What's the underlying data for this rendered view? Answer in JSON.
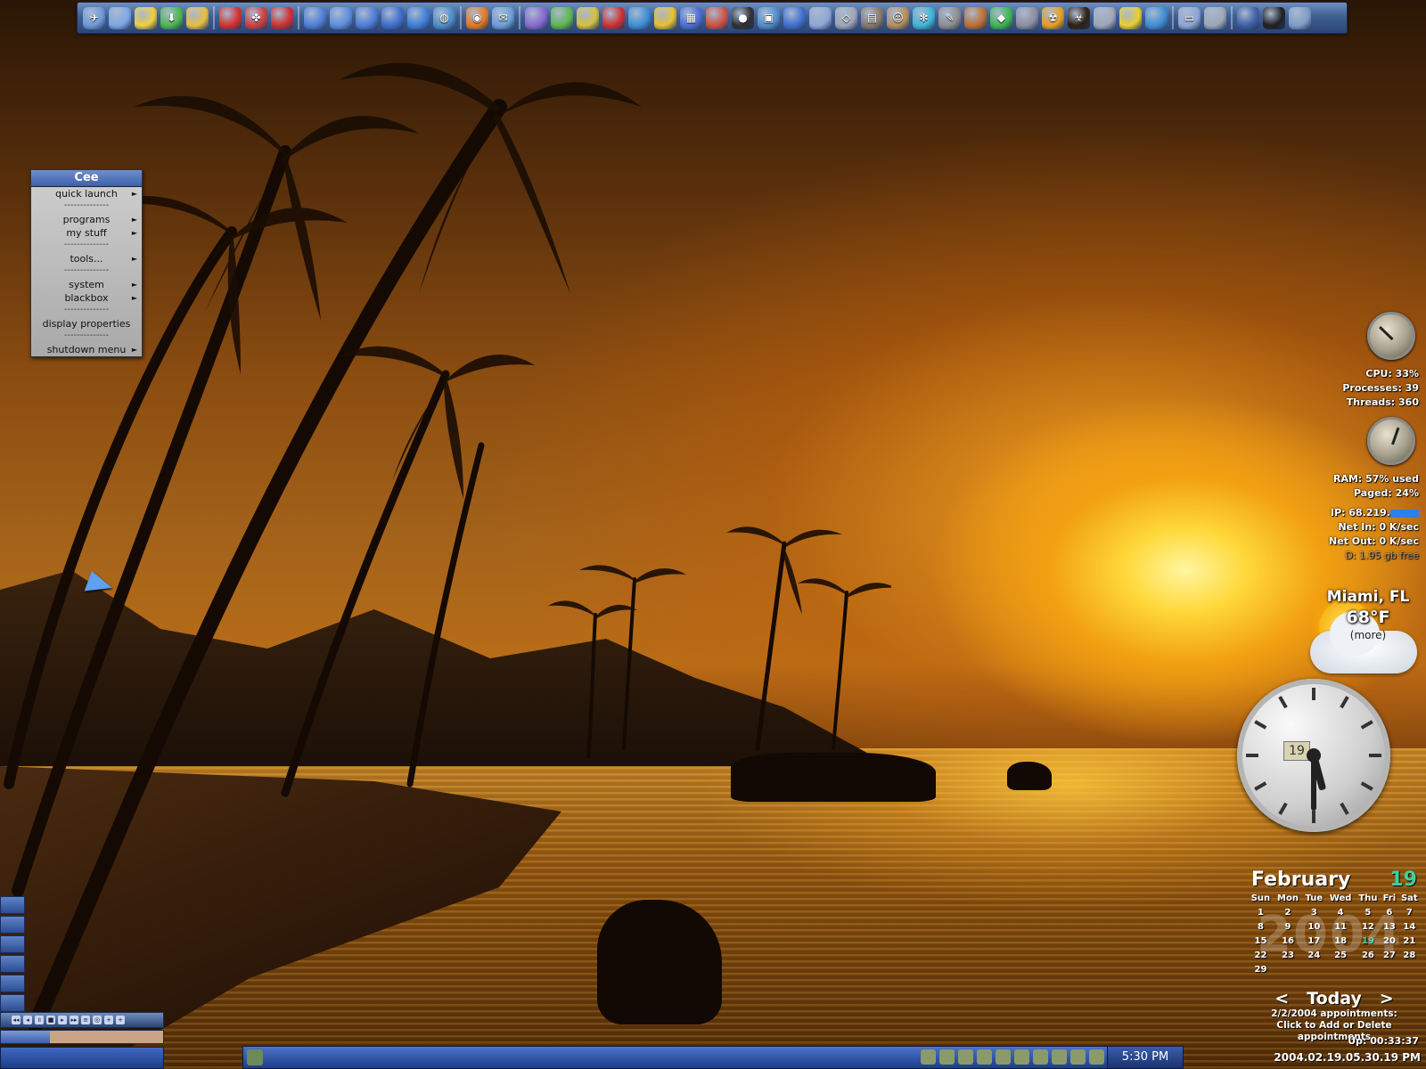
{
  "dock": {
    "icons": [
      {
        "name": "desktop-icon",
        "glyph": "✈",
        "color": "#6f9ad8"
      },
      {
        "name": "folder-icon",
        "glyph": "",
        "color": "#7fa8e8"
      },
      {
        "name": "works-icon",
        "glyph": "",
        "color": "#f0d040"
      },
      {
        "name": "download-icon",
        "glyph": "⬇",
        "color": "#4fb84f"
      },
      {
        "name": "folder-yellow-icon",
        "glyph": "",
        "color": "#e8c040"
      },
      {
        "sep": true
      },
      {
        "name": "pdf-icon",
        "glyph": "",
        "color": "#d83030"
      },
      {
        "name": "color-icon",
        "glyph": "✤",
        "color": "#d04040"
      },
      {
        "name": "pdf-writer-icon",
        "glyph": "",
        "color": "#d03030"
      },
      {
        "sep": true
      },
      {
        "name": "w-icon",
        "glyph": "",
        "color": "#4f7fd8"
      },
      {
        "name": "k-icon",
        "glyph": "",
        "color": "#5f8fe0"
      },
      {
        "name": "p-icon",
        "glyph": "",
        "color": "#4f7fd8"
      },
      {
        "name": "u-icon",
        "glyph": "",
        "color": "#3f6fd0"
      },
      {
        "name": "wave-icon",
        "glyph": "",
        "color": "#3f7fd8"
      },
      {
        "name": "globe-icon",
        "glyph": "◍",
        "color": "#4f8fc8"
      },
      {
        "sep": true
      },
      {
        "name": "firefox-icon",
        "glyph": "◉",
        "color": "#e87a20"
      },
      {
        "name": "mail-icon",
        "glyph": "✉",
        "color": "#6fa0d8"
      },
      {
        "sep": true
      },
      {
        "name": "dotnet-icon",
        "glyph": "",
        "color": "#8a6ad0"
      },
      {
        "name": "dreamweaver-icon",
        "glyph": "",
        "color": "#5fb84f"
      },
      {
        "name": "fireworks-icon",
        "glyph": "",
        "color": "#d8c040"
      },
      {
        "name": "flash-icon",
        "glyph": "",
        "color": "#d03030"
      },
      {
        "name": "freehand-icon",
        "glyph": "",
        "color": "#3f8fd8"
      },
      {
        "name": "seven-icon",
        "glyph": "",
        "color": "#e8c030"
      },
      {
        "name": "calendar-app-icon",
        "glyph": "▦",
        "color": "#4f6fd8"
      },
      {
        "name": "gplus-icon",
        "glyph": "",
        "color": "#d05040"
      },
      {
        "name": "ball-icon",
        "glyph": "●",
        "color": "#303030"
      },
      {
        "name": "cube-icon",
        "glyph": "▣",
        "color": "#4f8fd0"
      },
      {
        "name": "3d-icon",
        "glyph": "",
        "color": "#3f6fd0"
      },
      {
        "name": "mouse-icon",
        "glyph": "",
        "color": "#8fa8d8"
      },
      {
        "name": "box-icon",
        "glyph": "◇",
        "color": "#9fa8b8"
      },
      {
        "name": "photo-icon",
        "glyph": "▤",
        "color": "#8a7a6a"
      },
      {
        "name": "face-icon",
        "glyph": "☺",
        "color": "#b89060"
      },
      {
        "name": "snowflake-icon",
        "glyph": "✻",
        "color": "#3fb8d8"
      },
      {
        "name": "pen-icon",
        "glyph": "✎",
        "color": "#8f8f8f"
      },
      {
        "name": "paint-icon",
        "glyph": "",
        "color": "#c07030"
      },
      {
        "name": "green-diamond-icon",
        "glyph": "◆",
        "color": "#3fb84f"
      },
      {
        "name": "six-icon",
        "glyph": "",
        "color": "#8f8f9f"
      },
      {
        "name": "radioactive-icon",
        "glyph": "☢",
        "color": "#e8a020"
      },
      {
        "name": "biohazard-icon",
        "glyph": "☣",
        "color": "#302010"
      },
      {
        "name": "tools-icon",
        "glyph": "",
        "color": "#9fa8b8"
      },
      {
        "name": "ue-icon",
        "glyph": "",
        "color": "#e8d030"
      },
      {
        "name": "search-icon",
        "glyph": "",
        "color": "#3f8fd8"
      },
      {
        "sep": true
      },
      {
        "name": "screen-icon",
        "glyph": "▭",
        "color": "#8fa8d8"
      },
      {
        "name": "drive-icon",
        "glyph": "",
        "color": "#9fa8b8"
      },
      {
        "sep": true
      },
      {
        "name": "grid-icon",
        "glyph": "",
        "color": "#3f5fa8"
      },
      {
        "name": "eight-ball-icon",
        "glyph": "",
        "color": "#202020"
      },
      {
        "name": "trash-icon",
        "glyph": "",
        "color": "#7f9fc8"
      }
    ]
  },
  "menu": {
    "title": "Cee",
    "items": [
      {
        "label": "quick launch",
        "arrow": true
      },
      {
        "sep": true
      },
      {
        "label": "programs",
        "arrow": true
      },
      {
        "label": "my stuff",
        "arrow": true
      },
      {
        "sep": true
      },
      {
        "label": "tools...",
        "arrow": true
      },
      {
        "sep": true
      },
      {
        "label": "system",
        "arrow": true
      },
      {
        "label": "blackbox",
        "arrow": true
      },
      {
        "sep": true
      },
      {
        "label": "display properties",
        "arrow": false
      },
      {
        "sep": true
      },
      {
        "label": "shutdown menu",
        "arrow": true
      }
    ],
    "separator_text": "--------------"
  },
  "sysmon": {
    "cpu": "CPU: 33%",
    "processes": "Processes: 39",
    "threads": "Threads: 360",
    "ram": "RAM: 57% used",
    "paged": "Paged: 24%",
    "ip": "IP: 68.219.",
    "net_in": "Net In: 0 K/sec",
    "net_out": "Net Out: 0 K/sec",
    "disk": "D: 1.95 gb free",
    "cpu_level": 33,
    "ram_level": 57
  },
  "weather": {
    "city": "Miami, FL",
    "temp": "68°F",
    "more": "(more)"
  },
  "clock": {
    "date": "19",
    "hour": 5,
    "minute": 30
  },
  "calendar": {
    "month": "February",
    "day": "19",
    "year": "2004",
    "weekdays": [
      "Sun",
      "Mon",
      "Tue",
      "Wed",
      "Thu",
      "Fri",
      "Sat"
    ],
    "weeks": [
      [
        "1",
        "2",
        "3",
        "4",
        "5",
        "6",
        "7"
      ],
      [
        "8",
        "9",
        "10",
        "11",
        "12",
        "13",
        "14"
      ],
      [
        "15",
        "16",
        "17",
        "18",
        "19",
        "20",
        "21"
      ],
      [
        "22",
        "23",
        "24",
        "25",
        "26",
        "27",
        "28"
      ],
      [
        "29",
        "",
        "",
        "",
        "",
        "",
        ""
      ]
    ],
    "today": "19",
    "nav_prev": "<",
    "nav_label": "Today",
    "nav_next": ">",
    "appt_line1": "2/2/2004 appointments:",
    "appt_line2": "Click to Add or Delete appointments"
  },
  "uptime": "Up: 00:33:37",
  "timestamp": "2004.02.19.05.30.19 PM",
  "taskbar": {
    "time": "5:30 PM"
  },
  "media": {
    "buttons": [
      "◂◂",
      "◂",
      "॥",
      "■",
      "▸",
      "▸▸",
      "≡",
      "◎",
      "+",
      "+"
    ],
    "progress": 0.3
  }
}
